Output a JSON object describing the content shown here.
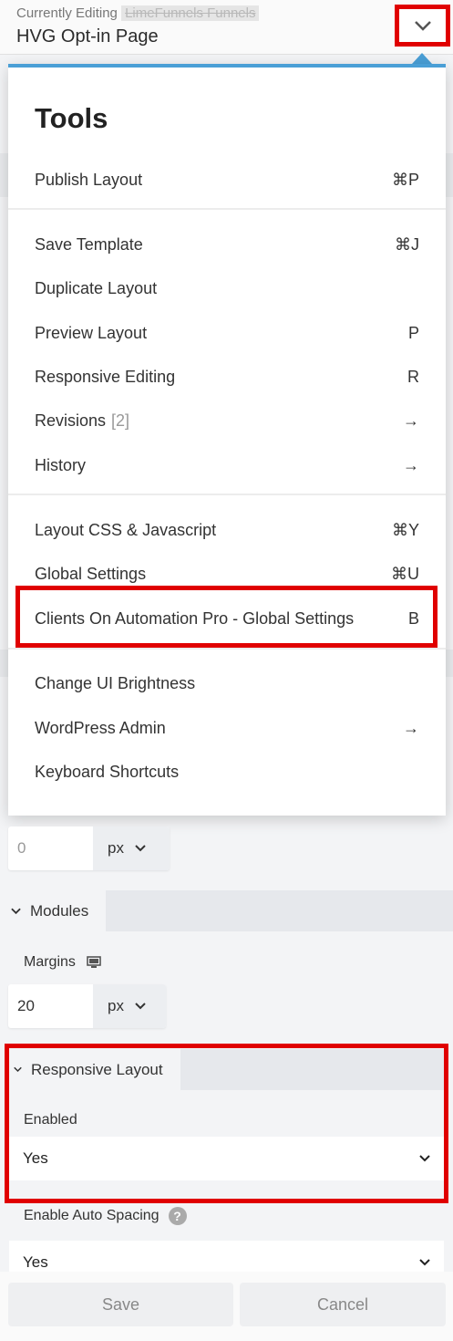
{
  "header": {
    "subtitle": "Currently Editing",
    "site_name": "LimeFunnels Funnels",
    "page_title": "HVG Opt-in Page"
  },
  "menu": {
    "title": "Tools",
    "items": [
      {
        "label": "Publish Layout",
        "shortcut": "⌘P"
      },
      {
        "label": "Save Template",
        "shortcut": "⌘J"
      },
      {
        "label": "Duplicate Layout",
        "shortcut": ""
      },
      {
        "label": "Preview Layout",
        "shortcut": "P"
      },
      {
        "label": "Responsive Editing",
        "shortcut": "R"
      },
      {
        "label": "Revisions",
        "count": "[2]",
        "shortcut": "→"
      },
      {
        "label": "History",
        "shortcut": "→"
      },
      {
        "label": "Layout CSS & Javascript",
        "shortcut": "⌘Y"
      },
      {
        "label": "Global Settings",
        "shortcut": "⌘U"
      },
      {
        "label": "Clients On Automation Pro - Global Settings",
        "shortcut": "B"
      },
      {
        "label": "Change UI Brightness",
        "shortcut": ""
      },
      {
        "label": "WordPress Admin",
        "shortcut": "→"
      },
      {
        "label": "Keyboard Shortcuts",
        "shortcut": ""
      }
    ]
  },
  "settings": {
    "row_padding": {
      "value": "0",
      "unit": "px"
    },
    "modules_section": "Modules",
    "margins": {
      "label": "Margins",
      "value": "20",
      "unit": "px"
    },
    "responsive_section": "Responsive Layout",
    "enabled": {
      "label": "Enabled",
      "value": "Yes"
    },
    "auto_spacing": {
      "label": "Enable Auto Spacing",
      "value": "Yes"
    }
  },
  "footer": {
    "save": "Save",
    "cancel": "Cancel"
  },
  "colors": {
    "accent": "#4a9fd6",
    "highlight": "#e00000"
  }
}
